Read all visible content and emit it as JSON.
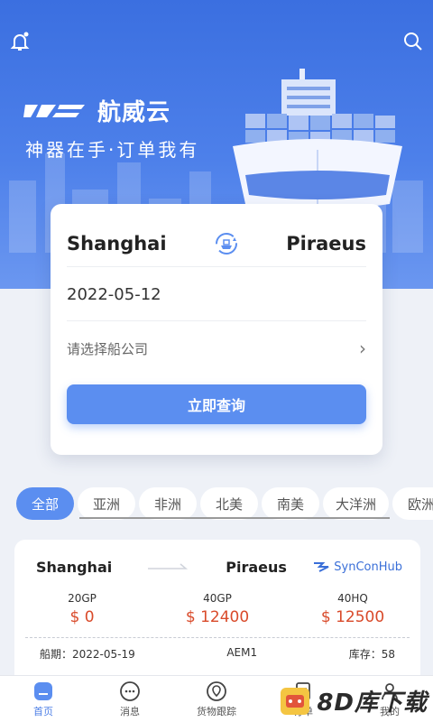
{
  "header": {
    "brand_name": "航威云",
    "slogan": "神器在手·订单我有"
  },
  "query": {
    "origin": "Shanghai",
    "destination": "Piraeus",
    "date": "2022-05-12",
    "company_placeholder": "请选择船公司",
    "submit_label": "立即查询"
  },
  "tabs": [
    {
      "label": "全部",
      "active": true
    },
    {
      "label": "亚洲"
    },
    {
      "label": "非洲"
    },
    {
      "label": "北美"
    },
    {
      "label": "南美"
    },
    {
      "label": "大洋洲"
    },
    {
      "label": "欧洲"
    }
  ],
  "result": {
    "origin": "Shanghai",
    "destination": "Piraeus",
    "carrier": "SynConHub",
    "prices": [
      {
        "type": "20GP",
        "price": "$ 0"
      },
      {
        "type": "40GP",
        "price": "$ 12400"
      },
      {
        "type": "40HQ",
        "price": "$ 12500"
      }
    ],
    "sailing_label": "船期：2022-05-19",
    "vessel": "AEM1",
    "stock_label": "库存：58"
  },
  "nav": [
    {
      "label": "首页",
      "icon": "home-icon",
      "active": true
    },
    {
      "label": "消息",
      "icon": "message-icon"
    },
    {
      "label": "货物跟踪",
      "icon": "tracking-icon"
    },
    {
      "label": "订单",
      "icon": "order-icon"
    },
    {
      "label": "我的",
      "icon": "profile-icon"
    }
  ],
  "watermark": {
    "text": "8D库下载"
  },
  "colors": {
    "primary": "#5b8ef0",
    "price": "#d94a2a",
    "hero": "#3b6fe0"
  }
}
